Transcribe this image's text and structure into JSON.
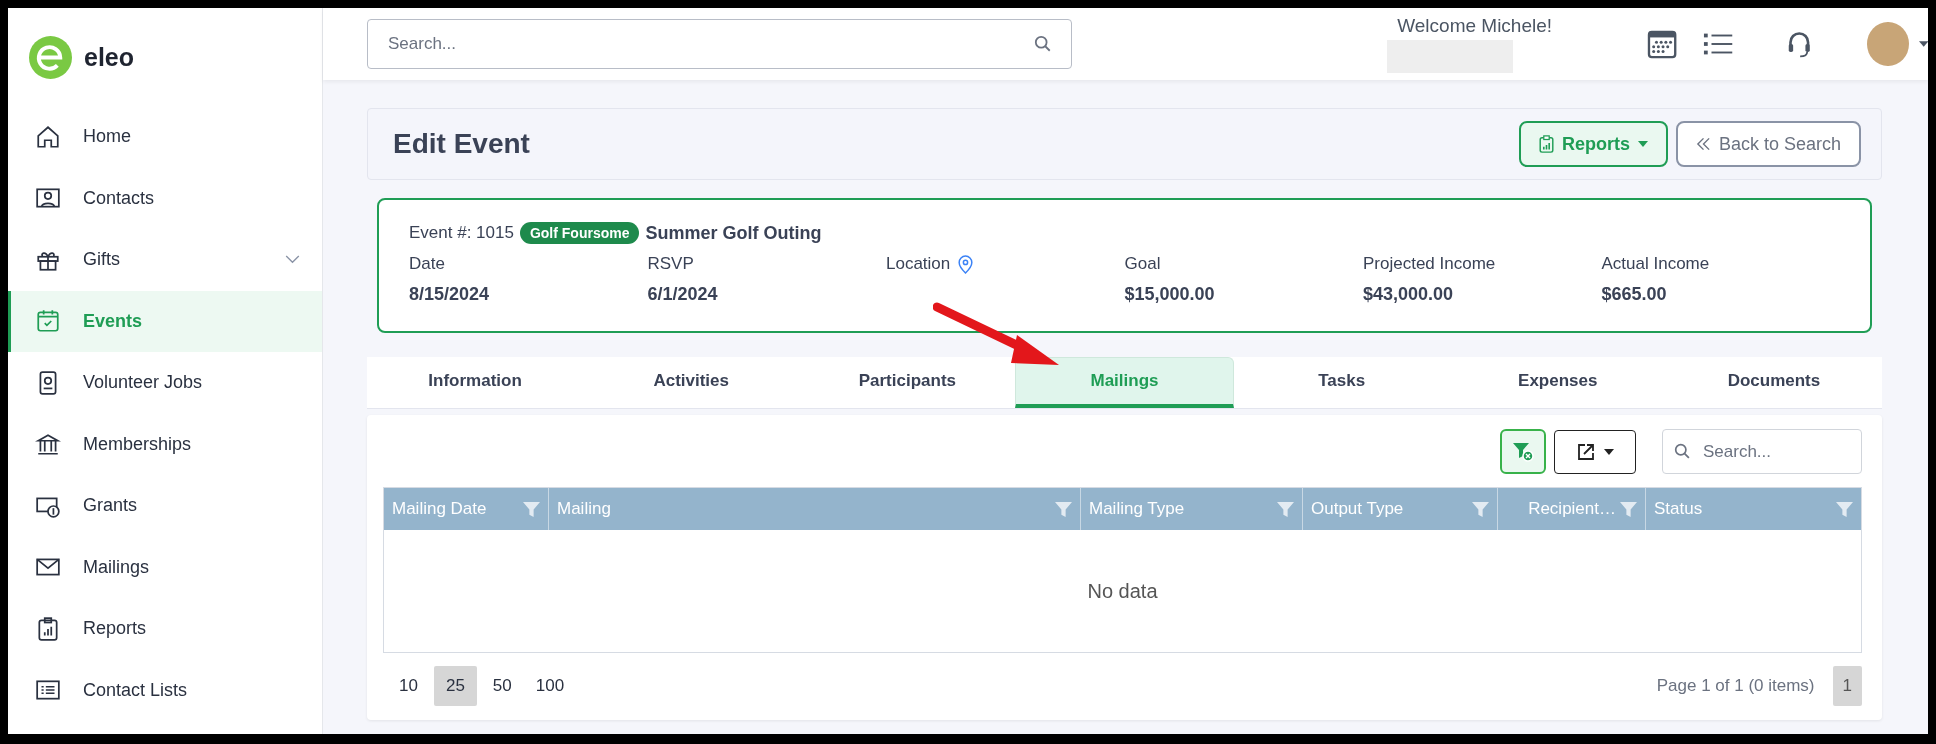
{
  "brand": {
    "name": "eleo"
  },
  "sidebar": {
    "items": [
      {
        "label": "Home",
        "kind": "link",
        "selected": false
      },
      {
        "label": "Contacts",
        "kind": "link",
        "selected": false
      },
      {
        "label": "Gifts",
        "kind": "group",
        "selected": false
      },
      {
        "label": "Events",
        "kind": "link",
        "selected": true
      },
      {
        "label": "Volunteer Jobs",
        "kind": "link",
        "selected": false
      },
      {
        "label": "Memberships",
        "kind": "link",
        "selected": false
      },
      {
        "label": "Grants",
        "kind": "link",
        "selected": false
      },
      {
        "label": "Mailings",
        "kind": "link",
        "selected": false
      },
      {
        "label": "Reports",
        "kind": "link",
        "selected": false
      },
      {
        "label": "Contact Lists",
        "kind": "link",
        "selected": false
      }
    ]
  },
  "header": {
    "search": {
      "placeholder": "Search..."
    },
    "welcome": "Welcome Michele!"
  },
  "page": {
    "title": "Edit Event",
    "reports_button": "Reports",
    "back_button": "Back to Search"
  },
  "event": {
    "number": "Event #: 1015",
    "tag": {
      "label": "Golf Foursome",
      "color": "#1e8a4c"
    },
    "name": "Summer Golf Outing",
    "fields": [
      {
        "label": "Date",
        "value": "8/15/2024",
        "kind": "text"
      },
      {
        "label": "RSVP",
        "value": "6/1/2024",
        "kind": "text"
      },
      {
        "label": "Location",
        "kind": "location"
      },
      {
        "label": "Goal",
        "value": "$15,000.00",
        "kind": "text"
      },
      {
        "label": "Projected Income",
        "value": "$43,000.00",
        "kind": "text"
      },
      {
        "label": "Actual Income",
        "value": "$665.00",
        "kind": "text"
      }
    ]
  },
  "tabs": [
    {
      "label": "Information",
      "selected": false
    },
    {
      "label": "Activities",
      "selected": false
    },
    {
      "label": "Participants",
      "selected": false
    },
    {
      "label": "Mailings",
      "selected": true
    },
    {
      "label": "Tasks",
      "selected": false
    },
    {
      "label": "Expenses",
      "selected": false
    },
    {
      "label": "Documents",
      "selected": false
    }
  ],
  "table": {
    "search": {
      "placeholder": "Search..."
    },
    "columns": [
      {
        "label": "Mailing Date"
      },
      {
        "label": "Mailing"
      },
      {
        "label": "Mailing Type"
      },
      {
        "label": "Output Type"
      },
      {
        "label": "Recipient…"
      },
      {
        "label": "Status"
      }
    ],
    "empty_text": "No data",
    "page_sizes": [
      {
        "label": "10",
        "selected": false
      },
      {
        "label": "25",
        "selected": true
      },
      {
        "label": "50",
        "selected": false
      },
      {
        "label": "100",
        "selected": false
      }
    ],
    "page_info": "Page 1 of 1 (0 items)",
    "pages": [
      {
        "label": "1",
        "selected": true
      }
    ]
  }
}
